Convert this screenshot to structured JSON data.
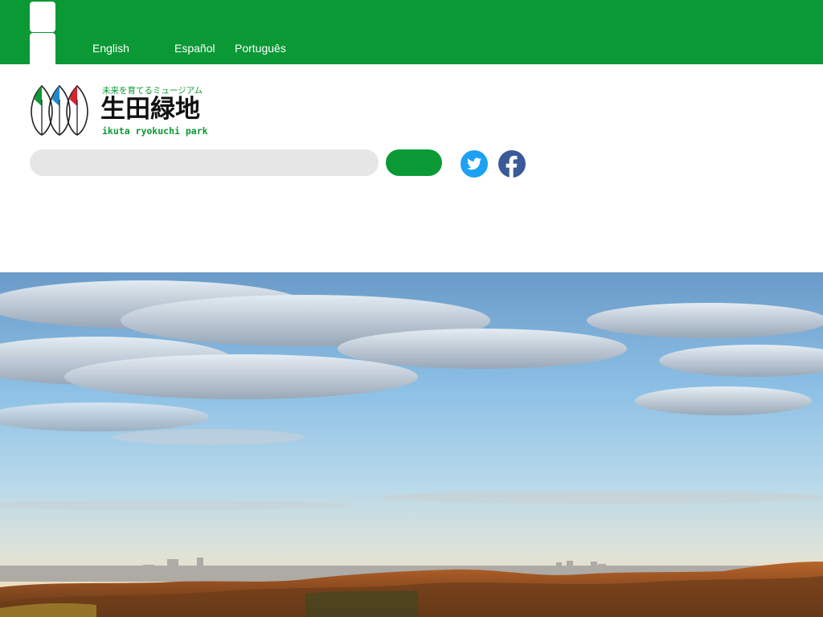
{
  "header": {
    "languages": [
      {
        "label": "English"
      },
      {
        "label": "Español"
      },
      {
        "label": "Português"
      }
    ]
  },
  "logo": {
    "tagline": "未来を育てるミュージアム",
    "name": "生田緑地",
    "name_en": "ikuta ryokuchi park",
    "leaf_colors": [
      "#0b9935",
      "#1e88d0",
      "#d8232a"
    ]
  },
  "search": {
    "placeholder": "",
    "value": "",
    "button_label": ""
  },
  "social": {
    "items": [
      {
        "icon": "twitter-icon",
        "color": "#1da1f2"
      },
      {
        "icon": "facebook-icon",
        "color": "#3b5998"
      }
    ]
  },
  "colors": {
    "brand_green": "#0b9935",
    "search_bg": "#e6e6e6"
  }
}
